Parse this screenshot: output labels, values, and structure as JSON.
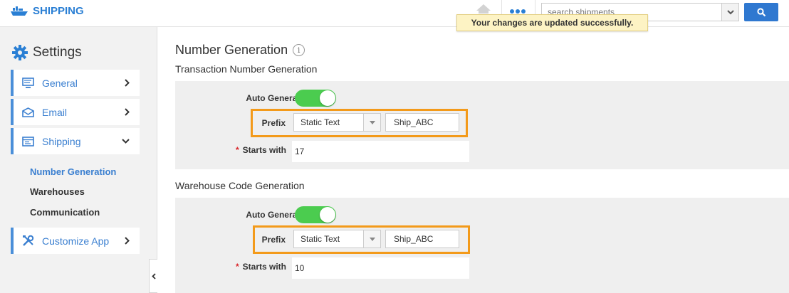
{
  "app": {
    "brand": "SHIPPING"
  },
  "header": {
    "search": {
      "placeholder": "search shipments"
    }
  },
  "toast": {
    "message": "Your changes are updated successfully."
  },
  "sidebar": {
    "title": "Settings",
    "items": [
      {
        "label": "General",
        "icon": "monitor-icon",
        "chevron": "chevron-right-icon"
      },
      {
        "label": "Email",
        "icon": "envelope-icon",
        "chevron": "chevron-right-icon"
      },
      {
        "label": "Shipping",
        "icon": "list-icon",
        "chevron": "chevron-down-icon"
      },
      {
        "label": "Customize App",
        "icon": "tools-icon",
        "chevron": "chevron-right-icon"
      }
    ],
    "sub_items": [
      {
        "label": "Number Generation",
        "active": true
      },
      {
        "label": "Warehouses",
        "active": false
      },
      {
        "label": "Communication",
        "active": false
      }
    ]
  },
  "main": {
    "title": "Number Generation",
    "info_glyph": "i",
    "sections": [
      {
        "title": "Transaction Number Generation",
        "auto_generate_label": "Auto Generate",
        "auto_generate_on": true,
        "prefix_label": "Prefix",
        "prefix_type": "Static Text",
        "prefix_value": "Ship_ABC",
        "starts_with_required": "*",
        "starts_with_label": "Starts with",
        "starts_with_value": "17"
      },
      {
        "title": "Warehouse Code Generation",
        "auto_generate_label": "Auto Generate",
        "auto_generate_on": true,
        "prefix_label": "Prefix",
        "prefix_type": "Static Text",
        "prefix_value": "Ship_ABC",
        "starts_with_required": "*",
        "starts_with_label": "Starts with",
        "starts_with_value": "10"
      }
    ]
  },
  "colors": {
    "accent": "#2a7fd4",
    "toggle_on": "#4bcc4f",
    "highlight": "#f39a1a",
    "toast_bg": "#fdf3c4",
    "required": "#d9262b"
  }
}
